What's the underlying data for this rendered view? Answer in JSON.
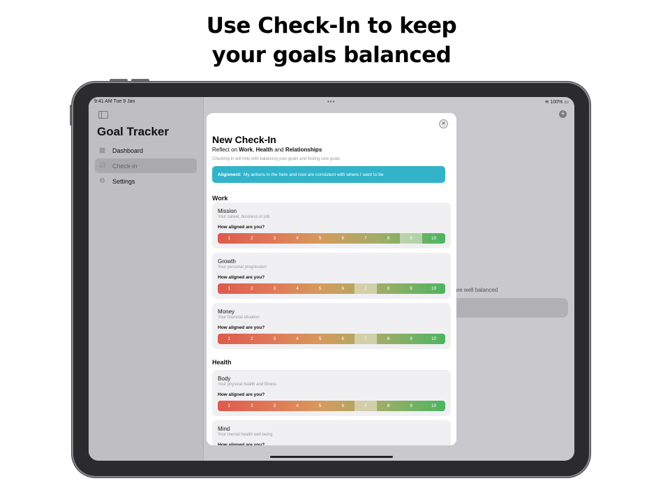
{
  "headline": [
    "Use Check-In to keep",
    "your goals balanced"
  ],
  "status_bar": {
    "time": "9:41 AM  Tue 9 Jan",
    "battery": "100%"
  },
  "sidebar": {
    "title": "Goal Tracker",
    "items": [
      {
        "label": "Dashboard",
        "icon": "dashboard-icon"
      },
      {
        "label": "Check-in",
        "icon": "checkin-icon",
        "active": true
      },
      {
        "label": "Settings",
        "icon": "gear-icon"
      }
    ]
  },
  "background": {
    "partial_text": "are well balanced"
  },
  "modal": {
    "title": "New Check-In",
    "subtitle_prefix": "Reflect on ",
    "subtitle_work": "Work",
    "subtitle_sep1": ", ",
    "subtitle_health": "Health",
    "subtitle_sep2": " and ",
    "subtitle_relationships": "Relationships",
    "hint": "Checking in will help with balancing your goals and finding new goals",
    "banner_label": "Alignment:",
    "banner_text": "My actions in the here and now are consistent with where I want to be",
    "question": "How aligned are you?",
    "sections": [
      {
        "title": "Work",
        "cards": [
          {
            "title": "Mission",
            "desc": "Your career, business or job",
            "selected": 9
          },
          {
            "title": "Growth",
            "desc": "Your personal progression",
            "selected": 7
          },
          {
            "title": "Money",
            "desc": "Your financial situation",
            "selected": 7
          }
        ]
      },
      {
        "title": "Health",
        "cards": [
          {
            "title": "Body",
            "desc": "Your physical health and fitness",
            "selected": 7
          },
          {
            "title": "Mind",
            "desc": "Your mental health well-being"
          }
        ]
      }
    ],
    "scale": [
      "1",
      "2",
      "3",
      "4",
      "5",
      "6",
      "7",
      "8",
      "9",
      "10"
    ]
  },
  "colors": {
    "banner": "#32b3c9",
    "scale_low": "#de5a4d",
    "scale_high": "#4cb560"
  }
}
